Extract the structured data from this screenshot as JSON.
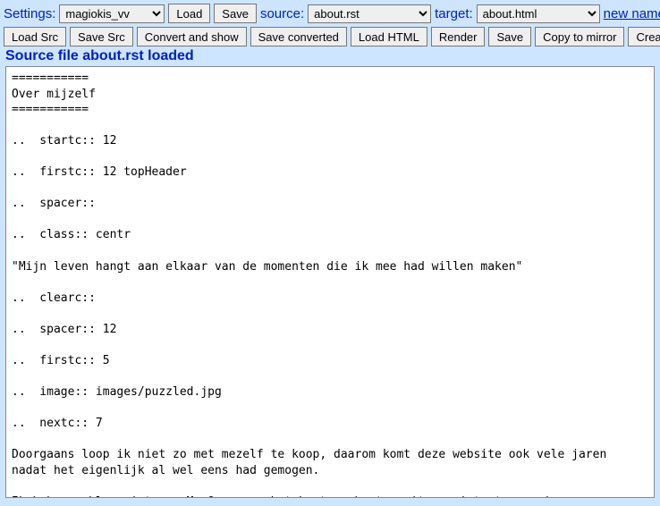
{
  "top": {
    "settings_label": "Settings:",
    "settings_value": "magiokis_vv",
    "load_label": "Load",
    "save_label": "Save",
    "source_label": "source:",
    "source_value": "about.rst",
    "target_label": "target:",
    "target_value": "about.html",
    "new_name_link": "new name"
  },
  "buttons": {
    "load_src": "Load Src",
    "save_src": "Save Src",
    "convert_show": "Convert and show",
    "save_converted": "Save converted",
    "load_html": "Load HTML",
    "render": "Render",
    "save": "Save",
    "copy_mirror": "Copy to mirror",
    "create": "Create"
  },
  "status_text": "Source file about.rst loaded",
  "editor_content": "===========\nOver mijzelf\n===========\n\n..  startc:: 12\n\n..  firstc:: 12 topHeader\n\n..  spacer::\n\n..  class:: centr\n\n\"Mijn leven hangt aan elkaar van de momenten die ik mee had willen maken\"\n\n..  clearc::\n\n..  spacer:: 12\n\n..  firstc:: 5\n\n..  image:: images/puzzled.jpg\n\n..  nextc:: 7\n\nDoorgaans loop ik niet zo met mezelf te koop, daarom komt deze website ook vele jaren\nnadat het eigenlijk al wel eens had gemogen.\n\nIk heb een blogruimte op My Opera en het kost me best moeite om iets te verzinnen om er\nte melden - laat staan regelmatig -  dus ben ik hier maar eens begonnen met pogingen om\neen klein biootje van mezelf te schrijven.\nEn dan blijkt dat er steeds meer boven komt borrelen...\n\n..  spacer::\n\nIk heb het voor het gemak maar onderverdeeld in onderwerpen:\n\n+   `Het verhaal (tot ongeveer 1987) <verhaal.html>`\n"
}
